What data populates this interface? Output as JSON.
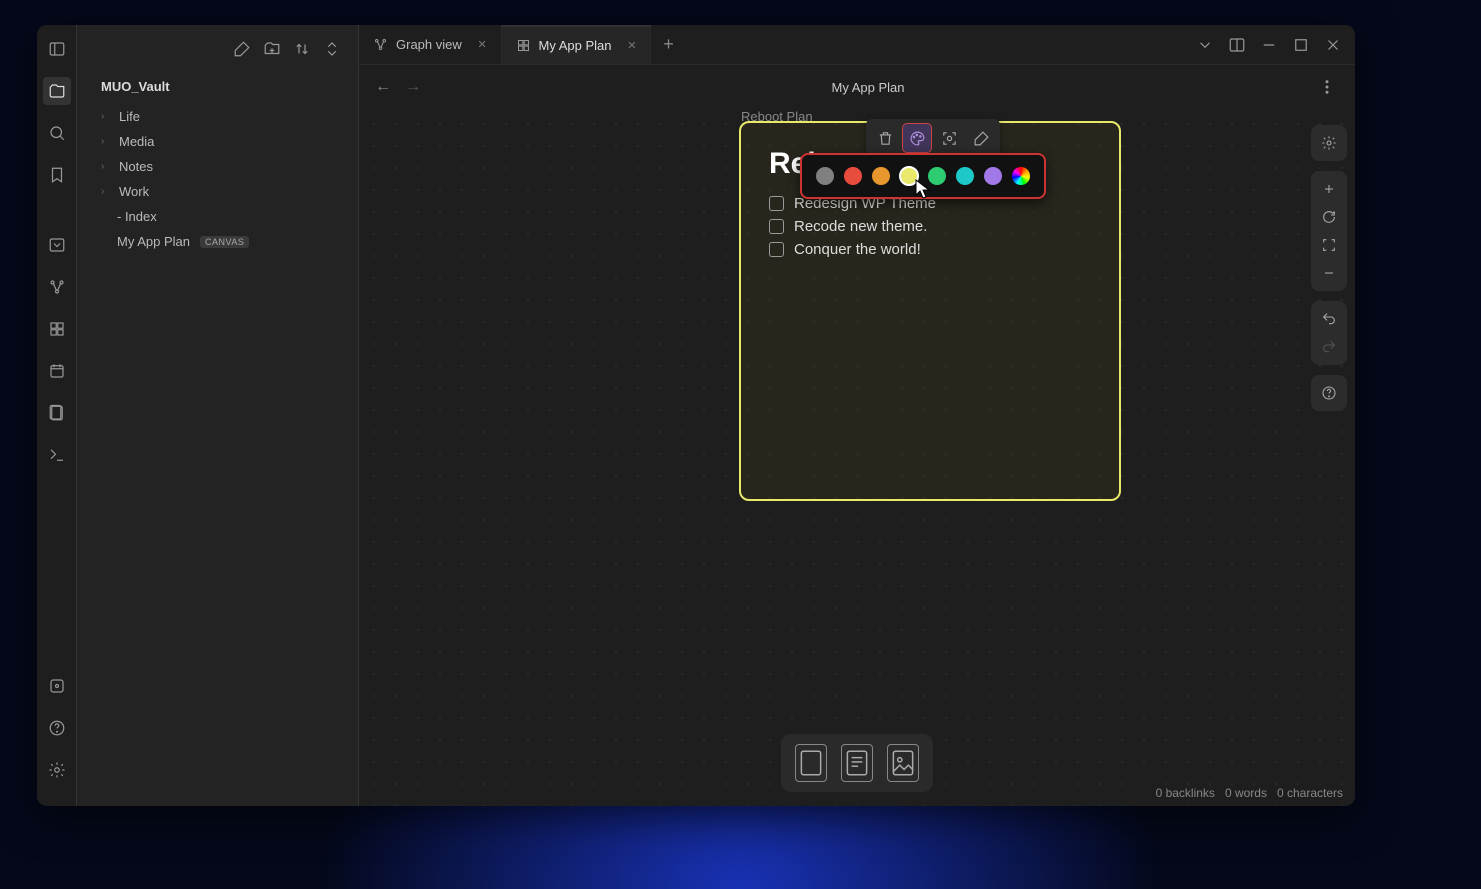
{
  "vault": {
    "name": "MUO_Vault"
  },
  "tree": {
    "items": [
      {
        "label": "Life"
      },
      {
        "label": "Media"
      },
      {
        "label": "Notes"
      },
      {
        "label": "Work"
      }
    ],
    "sub": [
      {
        "label": "- Index"
      },
      {
        "label": "My App Plan",
        "badge": "CANVAS"
      }
    ]
  },
  "tabs": {
    "graph": {
      "label": "Graph view"
    },
    "plan": {
      "label": "My App Plan"
    }
  },
  "pane": {
    "title": "My App Plan"
  },
  "card": {
    "label": "Reboot Plan",
    "title_partial": "Reb",
    "title": "Reboot Plan",
    "tasks": [
      "Redesign WP Theme",
      "Recode new theme.",
      "Conquer the world!"
    ]
  },
  "colors": {
    "palette": [
      "#808080",
      "#e74c3c",
      "#e8962e",
      "#e8e86a",
      "#2ecc71",
      "#1cc8c8",
      "#a078e8"
    ],
    "selected_index": 3
  },
  "status": {
    "backlinks": "0 backlinks",
    "words": "0 words",
    "chars": "0 characters"
  }
}
